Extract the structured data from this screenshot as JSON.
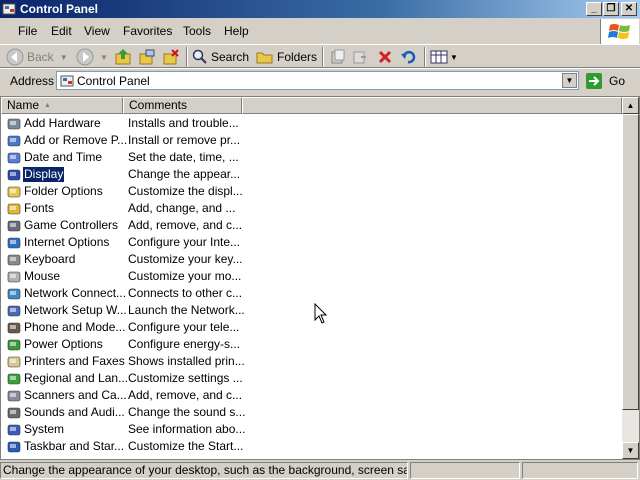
{
  "window": {
    "title": "Control Panel"
  },
  "menu": [
    "File",
    "Edit",
    "View",
    "Favorites",
    "Tools",
    "Help"
  ],
  "toolbar": {
    "back": "Back",
    "search": "Search",
    "folders": "Folders"
  },
  "address": {
    "label": "Address",
    "value": "Control Panel",
    "go": "Go"
  },
  "columns": {
    "name": "Name",
    "comments": "Comments"
  },
  "items": [
    {
      "name": "Add Hardware",
      "comment": "Installs and trouble...",
      "icon": "hardware-icon"
    },
    {
      "name": "Add or Remove P...",
      "comment": "Install or remove pr...",
      "icon": "add-remove-icon"
    },
    {
      "name": "Date and Time",
      "comment": "Set the date, time, ...",
      "icon": "clock-icon"
    },
    {
      "name": "Display",
      "comment": "Change the appear...",
      "icon": "monitor-icon"
    },
    {
      "name": "Folder Options",
      "comment": "Customize the displ...",
      "icon": "folder-icon"
    },
    {
      "name": "Fonts",
      "comment": "Add, change, and ...",
      "icon": "fonts-folder-icon"
    },
    {
      "name": "Game Controllers",
      "comment": "Add, remove, and c...",
      "icon": "joystick-icon"
    },
    {
      "name": "Internet Options",
      "comment": "Configure your Inte...",
      "icon": "globe-icon"
    },
    {
      "name": "Keyboard",
      "comment": "Customize your key...",
      "icon": "keyboard-icon"
    },
    {
      "name": "Mouse",
      "comment": "Customize your mo...",
      "icon": "mouse-icon"
    },
    {
      "name": "Network Connect...",
      "comment": "Connects to other c...",
      "icon": "network-icon"
    },
    {
      "name": "Network Setup W...",
      "comment": "Launch the Network...",
      "icon": "network-wizard-icon"
    },
    {
      "name": "Phone and Mode...",
      "comment": "Configure your tele...",
      "icon": "phone-icon"
    },
    {
      "name": "Power Options",
      "comment": "Configure energy-s...",
      "icon": "power-icon"
    },
    {
      "name": "Printers and Faxes",
      "comment": "Shows installed prin...",
      "icon": "printer-icon"
    },
    {
      "name": "Regional and Lan...",
      "comment": "Customize settings ...",
      "icon": "regional-globe-icon"
    },
    {
      "name": "Scanners and Ca...",
      "comment": "Add, remove, and c...",
      "icon": "scanner-icon"
    },
    {
      "name": "Sounds and Audi...",
      "comment": "Change the sound s...",
      "icon": "speaker-icon"
    },
    {
      "name": "System",
      "comment": "See information abo...",
      "icon": "computer-icon"
    },
    {
      "name": "Taskbar and Star...",
      "comment": "Customize the Start...",
      "icon": "taskbar-icon"
    }
  ],
  "selected_index": 3,
  "status": {
    "text": "Change the appearance of your desktop, such as the background, screen saver, col"
  },
  "colors": {
    "title_start": "#0a246a",
    "title_end": "#a6caf0",
    "selection": "#0a246a"
  }
}
